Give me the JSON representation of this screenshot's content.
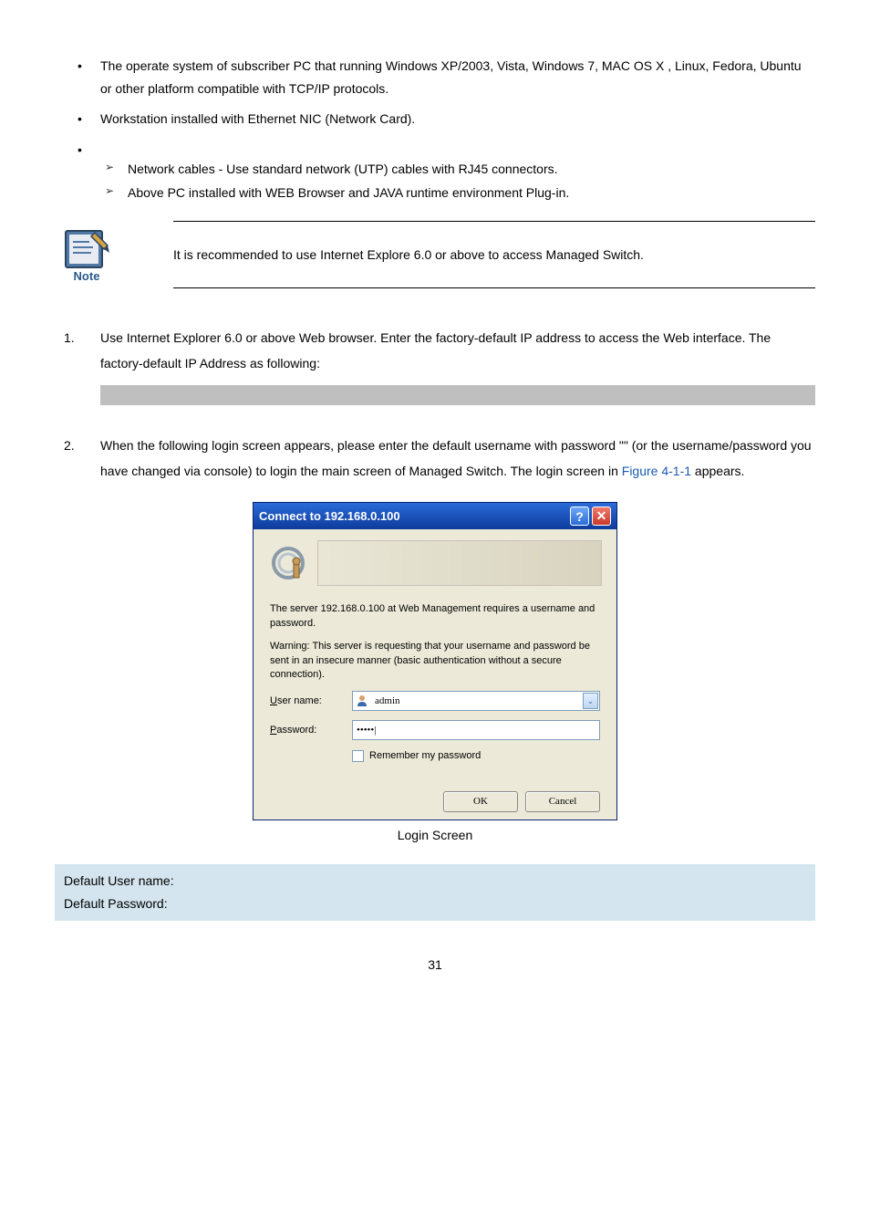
{
  "bullets": {
    "item1": "The operate system of subscriber PC that running Windows XP/2003, Vista, Windows 7, MAC OS X , Linux, Fedora, Ubuntu or other platform compatible with TCP/IP protocols.",
    "item2": "Workstation installed with Ethernet NIC (Network Card).",
    "arrow1": "Network cables - Use standard network (UTP) cables with RJ45 connectors.",
    "arrow2": "Above PC installed with WEB Browser and JAVA runtime environment Plug-in."
  },
  "note": {
    "label": "Note",
    "text": "It is recommended to use Internet Explore 6.0 or above to access Managed Switch."
  },
  "steps": {
    "n1": "1.",
    "s1": "Use Internet Explorer 6.0 or above Web browser. Enter the factory-default IP address to access the Web interface. The factory-default IP Address as following:",
    "n2": "2.",
    "s2a": "When the following login screen appears, please enter the default username ",
    "s2b": " with password \"",
    "s2c": "\" (or the username/password you have changed via console) to login the main screen of Managed Switch. The login screen in ",
    "figref": "Figure 4-1-1",
    "s2d": " appears."
  },
  "dialog": {
    "title": "Connect to 192.168.0.100",
    "help": "?",
    "close": "✕",
    "body1": "The server 192.168.0.100 at Web Management requires a username and password.",
    "body2": "Warning: This server is requesting that your username and password be sent in an insecure manner (basic authentication without a secure connection).",
    "username_label_u": "U",
    "username_label_rest": "ser name:",
    "username_value": "admin",
    "password_label_p": "P",
    "password_label_rest": "assword:",
    "password_value": "•••••|",
    "remember_r": "R",
    "remember_rest": "emember my password",
    "ok": "OK",
    "cancel": "Cancel",
    "dropdown_arrow": "⌄"
  },
  "caption_prefix": "Login Screen",
  "defaults": {
    "line1": "Default User name: ",
    "line2": "Default Password: "
  },
  "page_number": "31"
}
